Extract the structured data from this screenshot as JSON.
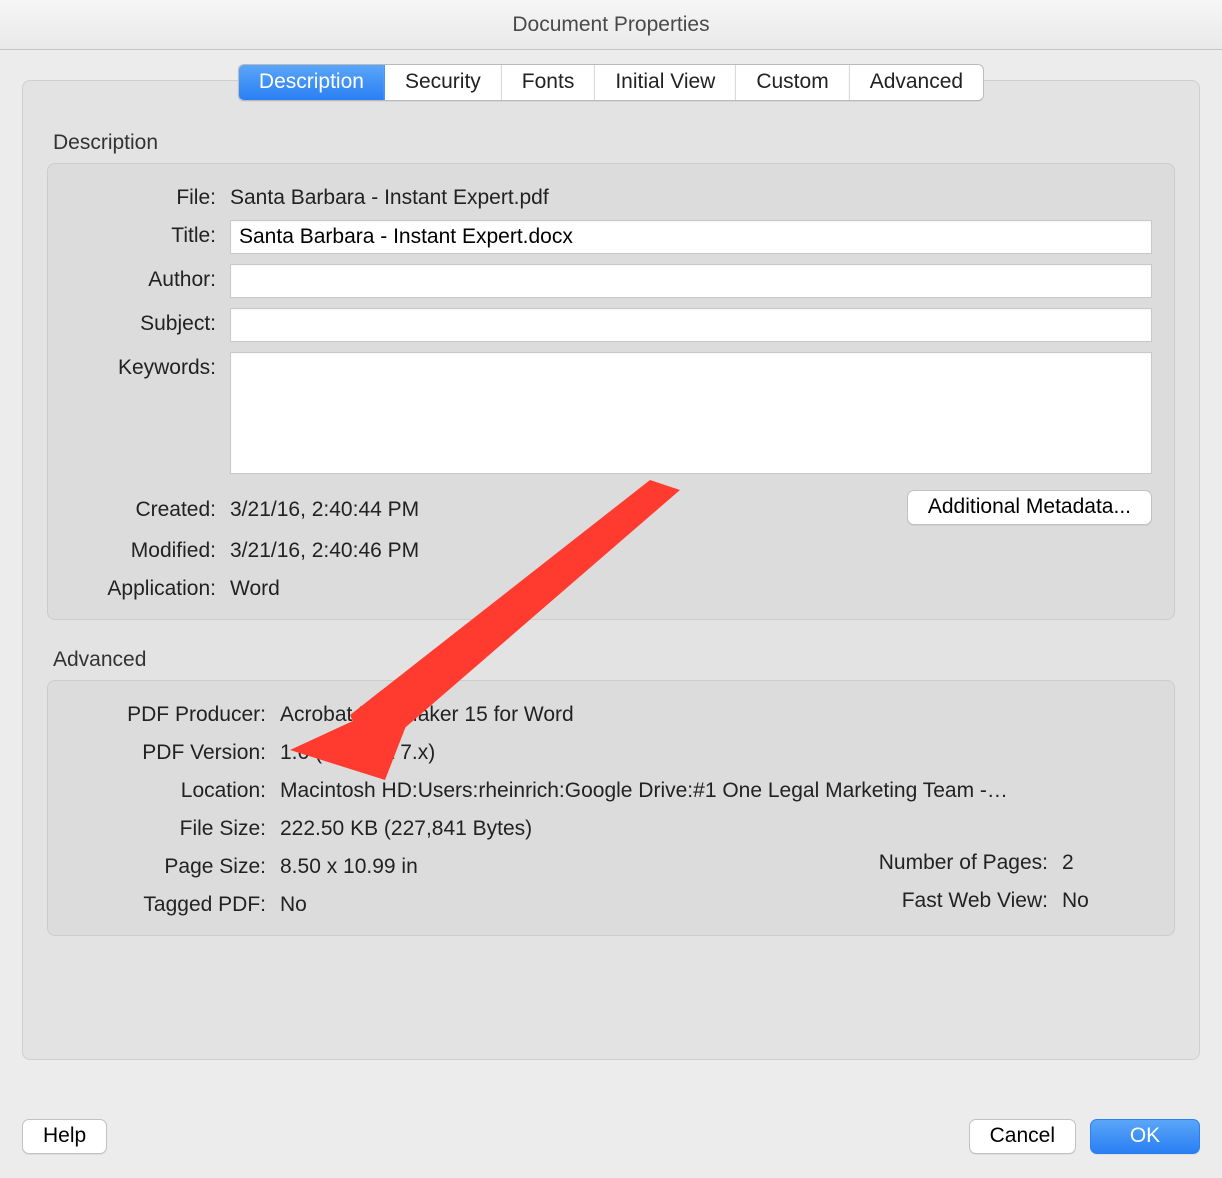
{
  "window": {
    "title": "Document Properties"
  },
  "tabs": {
    "t0": "Description",
    "t1": "Security",
    "t2": "Fonts",
    "t3": "Initial View",
    "t4": "Custom",
    "t5": "Advanced"
  },
  "groups": {
    "description": "Description",
    "advanced": "Advanced"
  },
  "labels": {
    "file": "File:",
    "title": "Title:",
    "author": "Author:",
    "subject": "Subject:",
    "keywords": "Keywords:",
    "created": "Created:",
    "modified": "Modified:",
    "application": "Application:",
    "pdf_producer": "PDF Producer:",
    "pdf_version": "PDF Version:",
    "location": "Location:",
    "file_size": "File Size:",
    "page_size": "Page Size:",
    "num_pages": "Number of Pages:",
    "tagged_pdf": "Tagged PDF:",
    "fast_web": "Fast Web View:"
  },
  "values": {
    "file": "Santa Barbara - Instant Expert.pdf",
    "title": "Santa Barbara - Instant Expert.docx",
    "author": "",
    "subject": "",
    "keywords": "",
    "created": "3/21/16, 2:40:44 PM",
    "modified": "3/21/16, 2:40:46 PM",
    "application": "Word",
    "pdf_producer": "Acrobat PDFMaker 15 for Word",
    "pdf_version": "1.6 (Acrobat 7.x)",
    "location": "Macintosh HD:Users:rheinrich:Google Drive:#1 One Legal Marketing Team -…",
    "file_size": "222.50 KB (227,841 Bytes)",
    "page_size": "8.50 x 10.99 in",
    "num_pages": "2",
    "tagged_pdf": "No",
    "fast_web": "No"
  },
  "buttons": {
    "additional_metadata": "Additional Metadata...",
    "help": "Help",
    "cancel": "Cancel",
    "ok": "OK"
  }
}
